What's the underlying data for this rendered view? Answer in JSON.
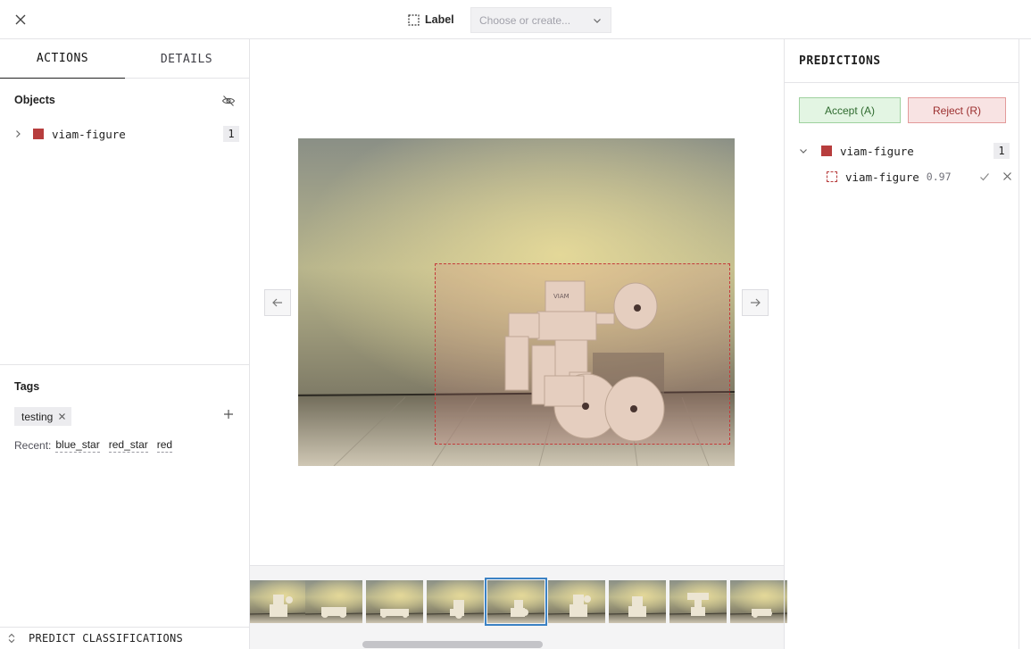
{
  "topbar": {
    "label_text": "Label",
    "label_select_placeholder": "Choose or create..."
  },
  "left": {
    "tabs": [
      {
        "label": "ACTIONS",
        "active": true
      },
      {
        "label": "DETAILS",
        "active": false
      }
    ],
    "objects_title": "Objects",
    "objects": [
      {
        "name": "viam-figure",
        "count": "1",
        "color": "#b73d3d"
      }
    ],
    "tags_title": "Tags",
    "tags": [
      {
        "label": "testing"
      }
    ],
    "recent_label": "Recent:",
    "recent": [
      "blue_star",
      "red_star",
      "red"
    ],
    "predict_label": "PREDICT CLASSIFICATIONS"
  },
  "right": {
    "title": "PREDICTIONS",
    "accept_label": "Accept (A)",
    "reject_label": "Reject (R)",
    "group": {
      "name": "viam-figure",
      "count": "1",
      "color": "#b73d3d"
    },
    "predictions": [
      {
        "name": "viam-figure",
        "score": "0.97"
      }
    ]
  },
  "icons": [
    "close-icon",
    "bounding-box-icon",
    "chevron-down-icon",
    "eye-off-icon",
    "chevron-right-icon",
    "plus-icon",
    "arrow-left-icon",
    "arrow-right-icon",
    "check-icon",
    "x-icon",
    "chevron-up-down-icon"
  ],
  "colors": {
    "label_red": "#b73d3d",
    "accept_green": "#e3f5e3",
    "reject_red": "#f8e3e3",
    "selected_thumb": "#3b82c4"
  },
  "thumbnails": {
    "count": 9,
    "selected_index": 4
  }
}
